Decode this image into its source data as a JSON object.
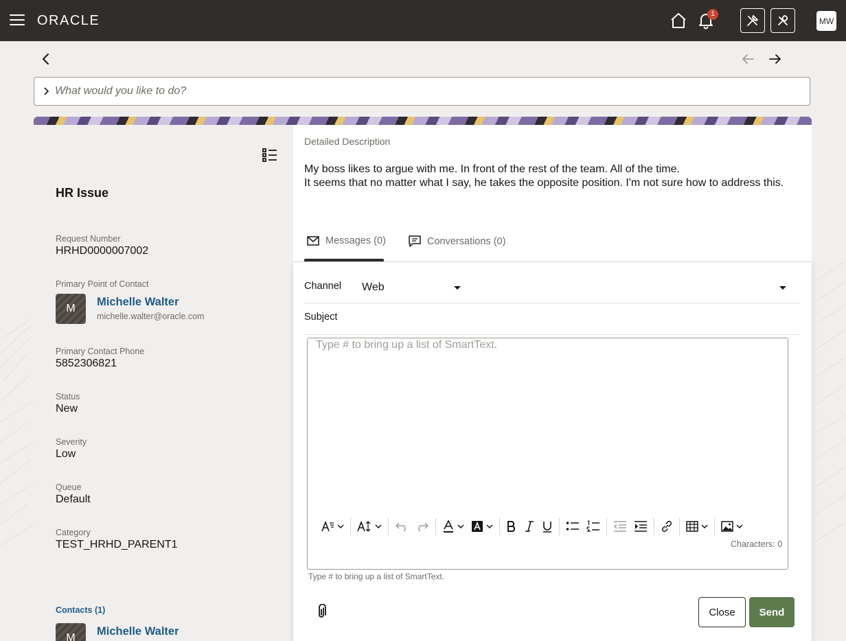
{
  "header": {
    "logo": "ORACLE",
    "notification_count": "1",
    "user_initials": "MW"
  },
  "search": {
    "placeholder": "What would you like to do?"
  },
  "request": {
    "title": "HR Issue",
    "fields": {
      "request_number_label": "Request Number",
      "request_number": "HRHD0000007002",
      "primary_contact_label": "Primary Point of Contact",
      "primary_contact_phone_label": "Primary Contact Phone",
      "primary_contact_phone": "5852306821",
      "status_label": "Status",
      "status": "New",
      "severity_label": "Severity",
      "severity": "Low",
      "queue_label": "Queue",
      "queue": "Default",
      "category_label": "Category",
      "category": "TEST_HRHD_PARENT1"
    },
    "primary_contact": {
      "initial": "M",
      "name": "Michelle Walter",
      "email": "michelle.walter@oracle.com"
    },
    "contacts": {
      "label": "Contacts (1)",
      "first": {
        "initial": "M",
        "name": "Michelle Walter"
      }
    }
  },
  "description": {
    "label": "Detailed Description",
    "lines": [
      "My boss likes to argue with me. In front of the rest of the team. All of the time.",
      "It seems that no matter what I say, he takes the opposite position. I'm not sure how to address this."
    ]
  },
  "tabs": [
    {
      "label": "Messages (0)",
      "icon": "envelope-icon",
      "active": true
    },
    {
      "label": "Conversations (0)",
      "icon": "chat-icon",
      "active": false
    }
  ],
  "composer": {
    "channel_label": "Channel",
    "channel_value": "Web",
    "subject_label": "Subject",
    "editor_placeholder": "Type # to bring up a list of SmartText.",
    "characters_label": "Characters: 0",
    "helper_text": "Type # to bring up a list of SmartText.",
    "close_label": "Close",
    "send_label": "Send"
  },
  "colors": {
    "header_bg": "#312d2a",
    "link": "#1d5d8b",
    "send_button": "#5e7b4e",
    "badge": "#c74634"
  }
}
